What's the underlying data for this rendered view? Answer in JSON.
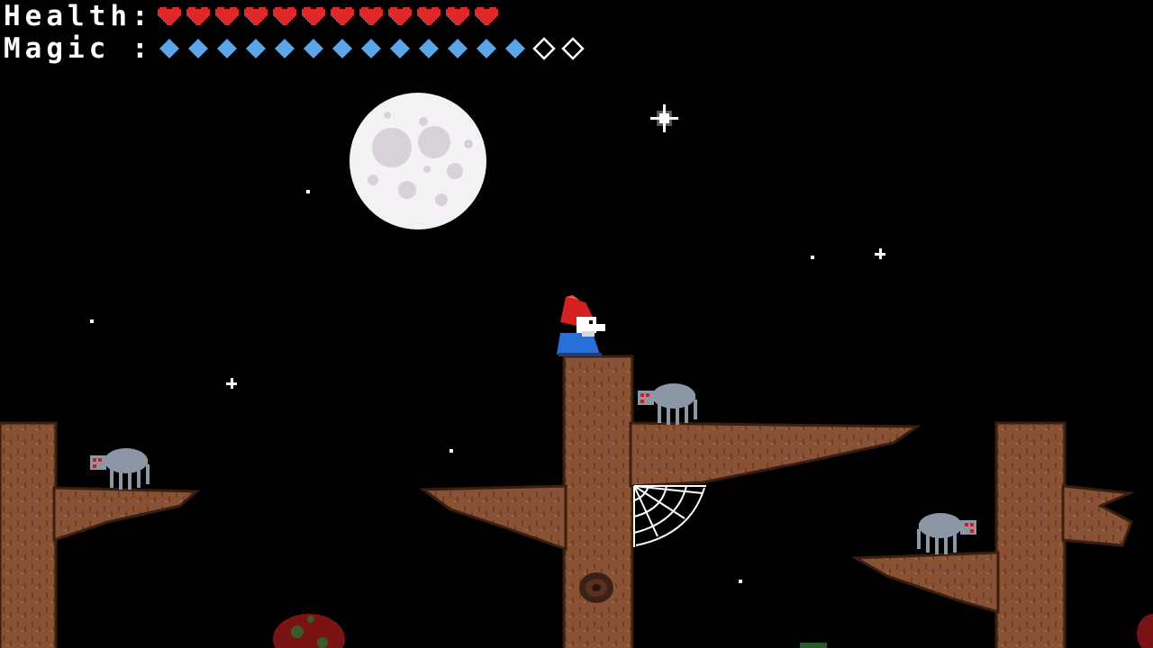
{
  "hud": {
    "health_label": "Health:",
    "magic_label": "Magic :",
    "health": {
      "current": 12,
      "max": 12,
      "color": "#e02828"
    },
    "magic": {
      "current": 13,
      "max": 15,
      "color": "#5aa6e8",
      "empty_color": "#ffffff"
    }
  },
  "scene": {
    "sky_color": "#000000",
    "moon_color": "#f4f2f4",
    "bark_color": "#8a5234",
    "bark_dark": "#5e3422",
    "player": {
      "hat_color": "#d42020",
      "robe_color": "#2a6ed8"
    },
    "spiders": {
      "count": 3,
      "color": "#8d96a6",
      "eye_color": "#d02020"
    }
  }
}
